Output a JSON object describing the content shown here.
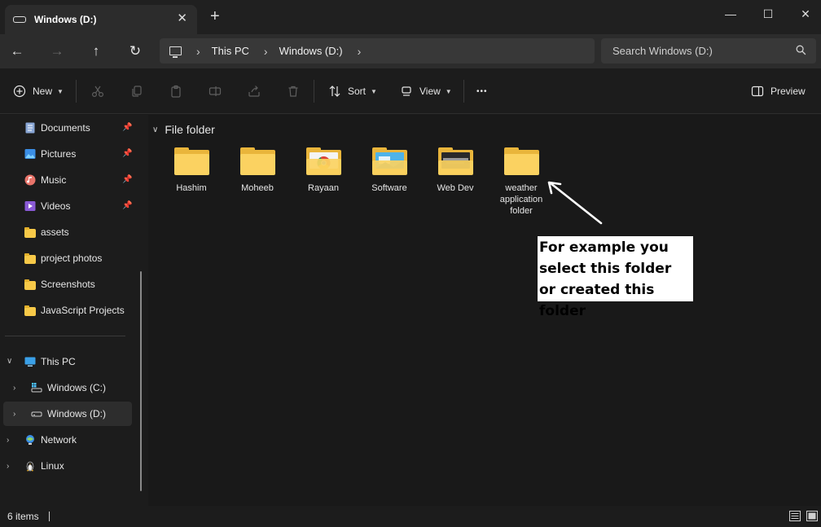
{
  "window": {
    "tab_title": "Windows (D:)",
    "tab_close": "✕",
    "new_tab": "+",
    "minimize": "—",
    "maximize": "☐",
    "close": "✕"
  },
  "nav": {
    "back": "←",
    "forward": "→",
    "up": "↑",
    "refresh": "↻",
    "breadcrumb": [
      "This PC",
      "Windows (D:)"
    ],
    "crumb_sep": "›",
    "search_placeholder": "Search Windows (D:)"
  },
  "toolbar": {
    "new_label": "New",
    "sort_label": "Sort",
    "view_label": "View",
    "more_label": "•••",
    "preview_label": "Preview"
  },
  "sidebar": {
    "quick_access": [
      {
        "label": "Documents",
        "icon": "documents-icon",
        "pinned": true
      },
      {
        "label": "Pictures",
        "icon": "pictures-icon",
        "pinned": true
      },
      {
        "label": "Music",
        "icon": "music-icon",
        "pinned": true
      },
      {
        "label": "Videos",
        "icon": "videos-icon",
        "pinned": true
      },
      {
        "label": "assets",
        "icon": "folder-icon",
        "pinned": false
      },
      {
        "label": "project photos",
        "icon": "folder-icon",
        "pinned": false
      },
      {
        "label": "Screenshots",
        "icon": "folder-icon",
        "pinned": false
      },
      {
        "label": "JavaScript Projects",
        "icon": "folder-icon",
        "pinned": false
      }
    ],
    "this_pc": "This PC",
    "drives": [
      "Windows (C:)",
      "Windows (D:)"
    ],
    "network": "Network",
    "linux": "Linux"
  },
  "content": {
    "group_header": "File folder",
    "folders": [
      {
        "name": "Hashim"
      },
      {
        "name": "Moheeb"
      },
      {
        "name": "Rayaan"
      },
      {
        "name": "Software"
      },
      {
        "name": "Web Dev"
      },
      {
        "name": "weather application folder"
      }
    ]
  },
  "annotation": {
    "text": "For example you select this folder or created this folder"
  },
  "status": {
    "item_count": "6 items"
  },
  "colors": {
    "folder": "#fbd261",
    "folder_back": "#e9b53b",
    "accent": "#4cc2ff"
  }
}
